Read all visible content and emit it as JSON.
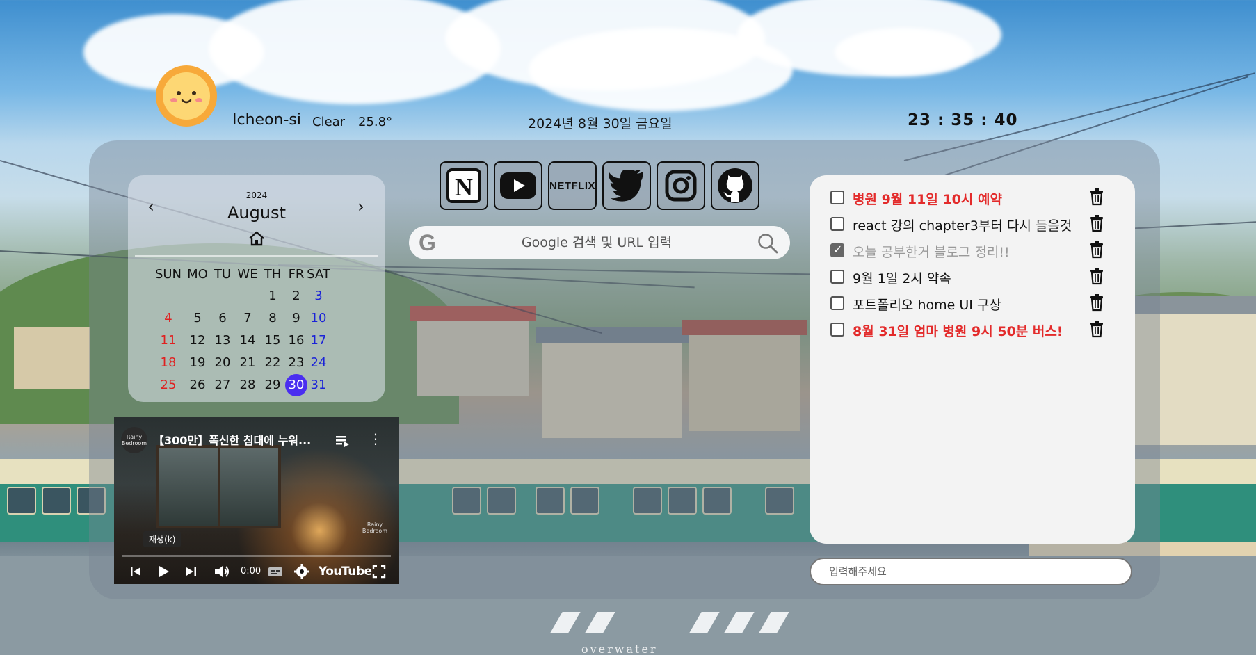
{
  "weather": {
    "city": "Icheon-si",
    "condition": "Clear",
    "temperature": "25.8°",
    "icon": "sun-face-icon"
  },
  "date_text": "2024년 8월 30일  금요일",
  "clock": "23 : 35 : 40",
  "calendar": {
    "year": "2024",
    "month": "August",
    "prev_icon": "chevron-left-icon",
    "next_icon": "chevron-right-icon",
    "home_icon": "home-icon",
    "weekdays": [
      "SUN",
      "MO",
      "TU",
      "WE",
      "TH",
      "FR",
      "SAT"
    ],
    "weeks": [
      [
        "",
        "",
        "",
        "",
        "1",
        "2",
        "3"
      ],
      [
        "4",
        "5",
        "6",
        "7",
        "8",
        "9",
        "10"
      ],
      [
        "11",
        "12",
        "13",
        "14",
        "15",
        "16",
        "17"
      ],
      [
        "18",
        "19",
        "20",
        "21",
        "22",
        "23",
        "24"
      ],
      [
        "25",
        "26",
        "27",
        "28",
        "29",
        "30",
        "31"
      ]
    ],
    "today": "30",
    "colors": {
      "sunday": "#e02020",
      "saturday": "#1a22d8",
      "today_bg": "#4a2ef0"
    }
  },
  "youtube": {
    "channel_avatar_text": "Rainy Bedroom",
    "title": "【300만】폭신한 침대에 누워...",
    "tooltip": "재생(k)",
    "corner_badge": "Rainy Bedroom",
    "time": "0:00",
    "logo": "YouTube",
    "icons": [
      "queue-icon",
      "more-vert-icon",
      "previous-icon",
      "play-icon",
      "next-icon",
      "volume-icon",
      "captions-icon",
      "settings-icon",
      "fullscreen-icon"
    ]
  },
  "shortcuts": [
    {
      "name": "notion",
      "label": "N",
      "icon": "notion-icon"
    },
    {
      "name": "youtube",
      "label": "",
      "icon": "youtube-icon"
    },
    {
      "name": "netflix",
      "label": "NETFLIX",
      "icon": "netflix-icon"
    },
    {
      "name": "twitter",
      "label": "",
      "icon": "twitter-icon"
    },
    {
      "name": "instagram",
      "label": "",
      "icon": "instagram-icon"
    },
    {
      "name": "github",
      "label": "",
      "icon": "github-icon"
    }
  ],
  "search": {
    "logo": "G",
    "placeholder": "Google 검색 및 URL 입력",
    "icon": "search-icon"
  },
  "todos": [
    {
      "text": "병원 9월 11일 10시 예약",
      "checked": false,
      "important": true
    },
    {
      "text": "react 강의 chapter3부터 다시 들을것",
      "checked": false,
      "important": false
    },
    {
      "text": "오늘 공부한거 블로그 정리!!",
      "checked": true,
      "important": false
    },
    {
      "text": "9월 1일 2시 약속",
      "checked": false,
      "important": false
    },
    {
      "text": "포트폴리오 home UI 구상",
      "checked": false,
      "important": false
    },
    {
      "text": "8월 31일 엄마 병원 9시 50분 버스!",
      "checked": false,
      "important": true
    }
  ],
  "todo_input": {
    "placeholder": "입력해주세요"
  },
  "watermark": "overwater"
}
